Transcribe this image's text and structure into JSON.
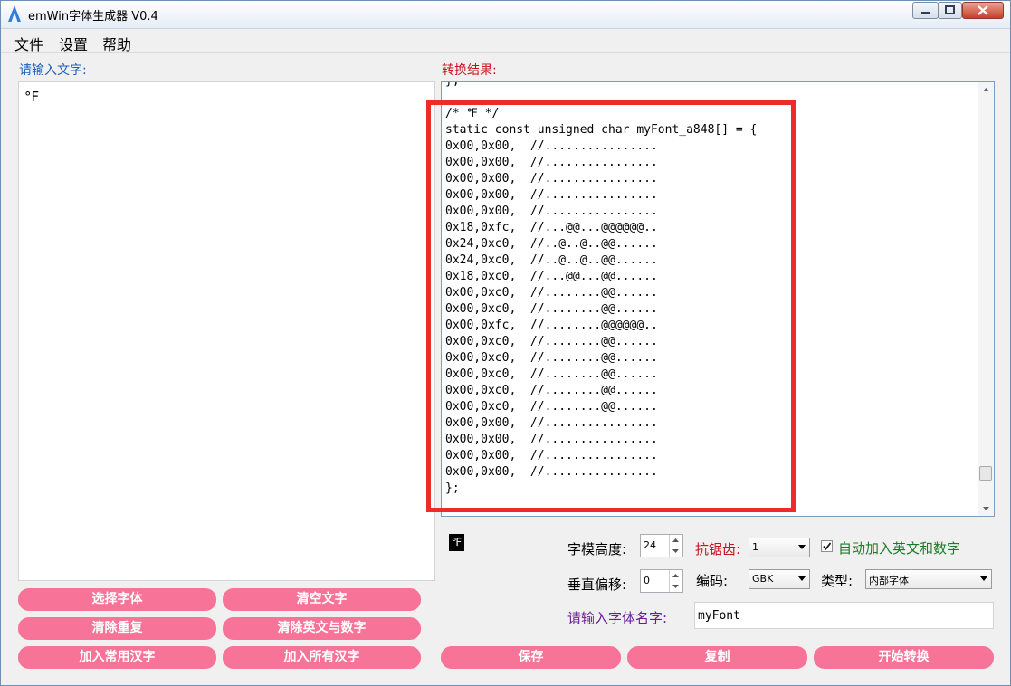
{
  "window": {
    "title": "emWin字体生成器 V0.4"
  },
  "menu": {
    "items": [
      "文件",
      "设置",
      "帮助"
    ]
  },
  "input_panel": {
    "label": "请输入文字:",
    "text": "°F"
  },
  "result_panel": {
    "label": "转换结果:",
    "code_lines": [
      "};",
      "",
      "/* ℉ */",
      "static const unsigned char myFont_a848[] = {",
      "0x00,0x00,  //................",
      "0x00,0x00,  //................",
      "0x00,0x00,  //................",
      "0x00,0x00,  //................",
      "0x00,0x00,  //................",
      "0x18,0xfc,  //...@@...@@@@@@..",
      "0x24,0xc0,  //..@..@..@@......",
      "0x24,0xc0,  //..@..@..@@......",
      "0x18,0xc0,  //...@@...@@......",
      "0x00,0xc0,  //........@@......",
      "0x00,0xc0,  //........@@......",
      "0x00,0xfc,  //........@@@@@@..",
      "0x00,0xc0,  //........@@......",
      "0x00,0xc0,  //........@@......",
      "0x00,0xc0,  //........@@......",
      "0x00,0xc0,  //........@@......",
      "0x00,0xc0,  //........@@......",
      "0x00,0x00,  //................",
      "0x00,0x00,  //................",
      "0x00,0x00,  //................",
      "0x00,0x00,  //................",
      "};"
    ]
  },
  "preview": {
    "glyph": "℉"
  },
  "settings": {
    "font_height_label": "字模高度:",
    "font_height_value": "24",
    "antialias_label": "抗锯齿:",
    "antialias_value": "1",
    "auto_add_label": "自动加入英文和数字",
    "auto_add_checked": true,
    "vertical_offset_label": "垂直偏移:",
    "vertical_offset_value": "0",
    "encoding_label": "编码:",
    "encoding_value": "GBK",
    "type_label": "类型:",
    "type_value": "内部字体",
    "font_name_label": "请输入字体名字:",
    "font_name_value": "myFont"
  },
  "buttons": {
    "select_font": "选择字体",
    "clear_text": "清空文字",
    "remove_duplicates": "清除重复",
    "remove_alnum": "清除英文与数字",
    "add_common_hanzi": "加入常用汉字",
    "add_all_hanzi": "加入所有汉字",
    "save": "保存",
    "copy": "复制",
    "start_convert": "开始转换"
  },
  "colors": {
    "button_pink": "#f77397",
    "highlight_red": "#ee2b2b",
    "label_blue": "#1e5fbf",
    "label_red": "#c8141e",
    "label_green": "#1f7a28",
    "label_purple": "#6a1b9a"
  }
}
